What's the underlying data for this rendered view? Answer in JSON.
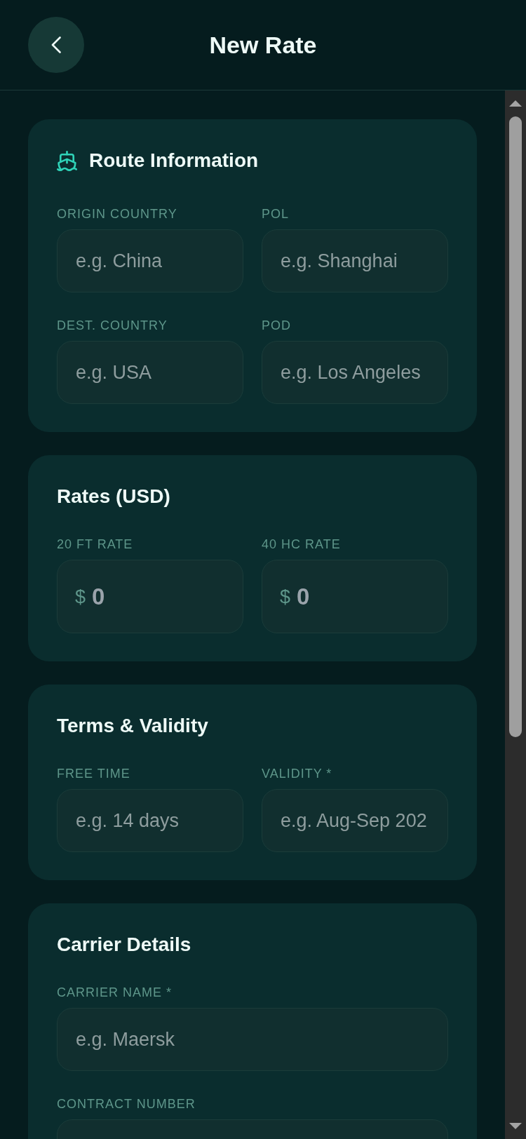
{
  "header": {
    "title": "New Rate"
  },
  "sections": [
    {
      "title": "Route Information",
      "icon": true,
      "kind": "grid",
      "fields": [
        {
          "kind": "text",
          "label": "ORIGIN COUNTRY",
          "placeholder": "e.g. China"
        },
        {
          "kind": "text",
          "label": "POL",
          "placeholder": "e.g. Shanghai"
        },
        {
          "kind": "text",
          "label": "DEST. COUNTRY",
          "placeholder": "e.g. USA"
        },
        {
          "kind": "text",
          "label": "POD",
          "placeholder": "e.g. Los Angeles"
        }
      ]
    },
    {
      "title": "Rates (USD)",
      "icon": false,
      "kind": "grid",
      "fields": [
        {
          "kind": "currency",
          "label": "20 FT RATE",
          "prefix": "$",
          "placeholder": "0"
        },
        {
          "kind": "currency",
          "label": "40 HC RATE",
          "prefix": "$",
          "placeholder": "0"
        }
      ]
    },
    {
      "title": "Terms & Validity",
      "icon": false,
      "kind": "grid",
      "fields": [
        {
          "kind": "text",
          "label": "FREE TIME",
          "placeholder": "e.g. 14 days"
        },
        {
          "kind": "text",
          "label": "VALIDITY *",
          "placeholder": "e.g. Aug-Sep 202"
        }
      ]
    },
    {
      "title": "Carrier Details",
      "icon": false,
      "kind": "stack",
      "fields": [
        {
          "kind": "text",
          "label": "CARRIER NAME *",
          "placeholder": "e.g. Maersk"
        },
        {
          "kind": "text",
          "label": "CONTRACT NUMBER"
        }
      ]
    }
  ]
}
